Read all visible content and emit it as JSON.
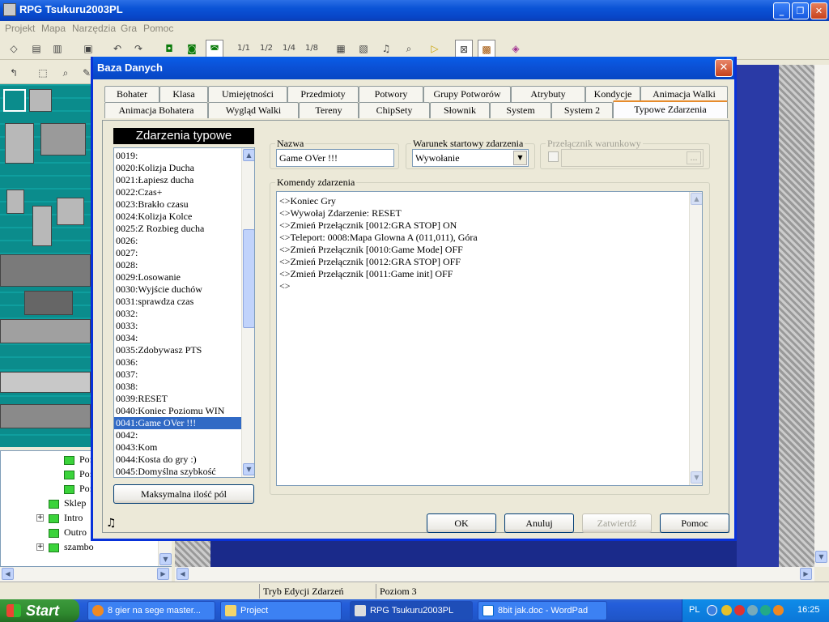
{
  "app": {
    "title": "RPG Tsukuru2003PL",
    "menu": [
      "Projekt",
      "Mapa",
      "Narzędzia",
      "Gra",
      "Pomoc"
    ],
    "window_controls": {
      "minimize": "_",
      "maximize": "❐",
      "close": "✕"
    }
  },
  "toolbar": {
    "layer_icons": [
      "1/1",
      "1/2",
      "1/4",
      "1/8"
    ]
  },
  "tree": {
    "items": [
      "Po:",
      "Po:",
      "Po:",
      "Sklep",
      "Intro",
      "Outro",
      "szambo"
    ]
  },
  "status": {
    "mode": "Tryb Edycji Zdarzeń",
    "level": "Poziom 3"
  },
  "dialog": {
    "title": "Baza Danych",
    "close": "✕",
    "tabs_row1": [
      "Bohater",
      "Klasa",
      "Umiejętności",
      "Przedmioty",
      "Potwory",
      "Grupy Potworów",
      "Atrybuty",
      "Kondycje",
      "Animacja Walki"
    ],
    "tabs_row2": [
      "Animacja Bohatera",
      "Wygląd Walki",
      "Tereny",
      "ChipSety",
      "Słownik",
      "System",
      "System 2",
      "Typowe Zdarzenia"
    ],
    "selected_tab": "Typowe Zdarzenia",
    "list_header": "Zdarzenia typowe",
    "list_items": [
      "0019:",
      "0020:Kolizja Ducha",
      "0021:Łapiesz ducha",
      "0022:Czas+",
      "0023:Brakło czasu",
      "0024:Kolizja Kolce",
      "0025:Z Rozbieg ducha",
      "0026:",
      "0027:",
      "0028:",
      "0029:Losowanie",
      "0030:Wyjście duchów",
      "0031:sprawdza czas",
      "0032:",
      "0033:",
      "0034:",
      "0035:Zdobywasz PTS",
      "0036:",
      "0037:",
      "0038:",
      "0039:RESET",
      "0040:Koniec Poziomu WIN",
      "0041:Game OVer !!!",
      "0042:",
      "0043:Kom",
      "0044:Kosta do gry :)",
      "0045:Domyślna szybkość"
    ],
    "selected_item": "0041:Game OVer !!!",
    "max_button": "Maksymalna ilość pól",
    "name_label": "Nazwa",
    "name_value": "Game OVer !!!",
    "trigger_label": "Warunek startowy zdarzenia",
    "trigger_value": "Wywołanie",
    "switch_label": "Przełącznik warunkowy",
    "switch_browse": "...",
    "commands_label": "Komendy zdarzenia",
    "commands": [
      "<>Koniec Gry",
      "<>Wywołaj Zdarzenie: RESET",
      "<>Zmień Przełącznik [0012:GRA STOP]  ON",
      "<>Teleport: 0008:Mapa Glowna A (011,011), Góra",
      "<>Zmień Przełącznik [0010:Game Mode]  OFF",
      "<>Zmień Przełącznik [0012:GRA STOP]  OFF",
      "<>Zmień Przełącznik [0011:Game init]  OFF",
      "<>"
    ],
    "buttons": {
      "ok": "OK",
      "cancel": "Anuluj",
      "apply": "Zatwierdź",
      "help": "Pomoc"
    },
    "music_icon": "♫"
  },
  "taskbar": {
    "start": "Start",
    "tasks": [
      "8 gier na sege master...",
      "Project",
      "RPG Tsukuru2003PL",
      "8bit jak.doc - WordPad"
    ],
    "lang": "PL",
    "clock": "16:25"
  }
}
